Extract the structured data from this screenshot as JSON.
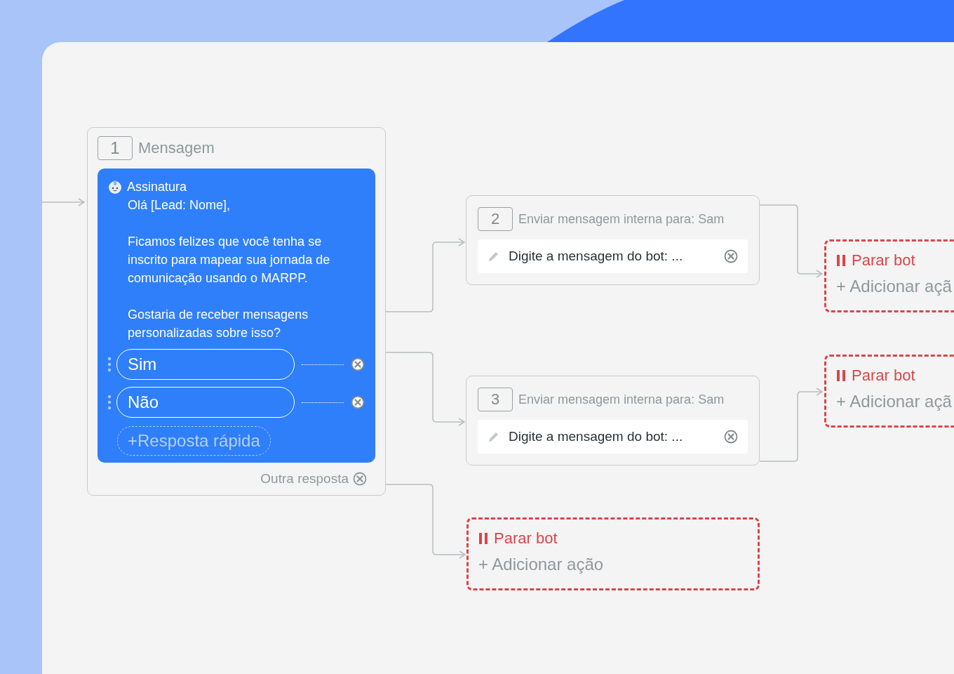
{
  "nodes": [
    {
      "kind": "message",
      "number": "1",
      "title": "Mensagem",
      "sender": "Assinatura",
      "paragraphs": [
        [
          "Olá [Lead: Nome],"
        ],
        [
          "Ficamos felizes que você tenha se",
          "inscrito para mapear sua jornada de",
          "comunicação usando o MARPP."
        ],
        [
          "Gostaria de receber mensagens",
          "personalizadas sobre isso?"
        ]
      ],
      "quick_replies": [
        "Sim",
        "Não"
      ],
      "add_reply": "+Resposta rápida",
      "other_reply": "Outra resposta"
    },
    {
      "kind": "internal",
      "number": "2",
      "title": "Enviar mensagem interna para: Sam",
      "input": "Digite a mensagem do bot: ..."
    },
    {
      "kind": "internal",
      "number": "3",
      "title": "Enviar mensagem interna para: Sam",
      "input": "Digite a mensagem do bot: ..."
    },
    {
      "kind": "stop",
      "label": "Parar bot",
      "add_action": "+ Adicionar açã"
    },
    {
      "kind": "stop",
      "label": "Parar bot",
      "add_action": "+ Adicionar açã"
    },
    {
      "kind": "stop",
      "label": "Parar bot",
      "add_action": "+ Adicionar ação"
    }
  ]
}
